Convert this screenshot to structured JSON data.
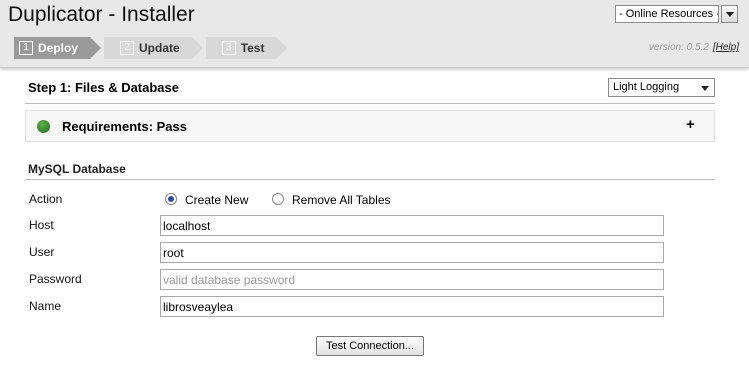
{
  "header": {
    "title": "Duplicator - Installer",
    "resources_label": "- Online Resources -",
    "version_text": "version: 0.5.2",
    "help_link": "[Help]"
  },
  "steps": [
    {
      "num": "1",
      "label": "Deploy",
      "active": true
    },
    {
      "num": "2",
      "label": "Update",
      "active": false
    },
    {
      "num": "3",
      "label": "Test",
      "active": false
    }
  ],
  "main": {
    "step_title": "Step 1: Files & Database",
    "logging_select": "Light Logging",
    "requirements_label": "Requirements: Pass",
    "requirements_toggle": "+",
    "requirements_status_color": "#2e8b2a"
  },
  "mysql": {
    "section_title": "MySQL Database",
    "action_label": "Action",
    "action_options": [
      "Create New",
      "Remove All Tables"
    ],
    "action_selected": "Create New",
    "host_label": "Host",
    "host_value": "localhost",
    "user_label": "User",
    "user_value": "root",
    "password_label": "Password",
    "password_placeholder": "valid database password",
    "name_label": "Name",
    "name_value": "librosveaylea",
    "test_button": "Test Connection..."
  }
}
